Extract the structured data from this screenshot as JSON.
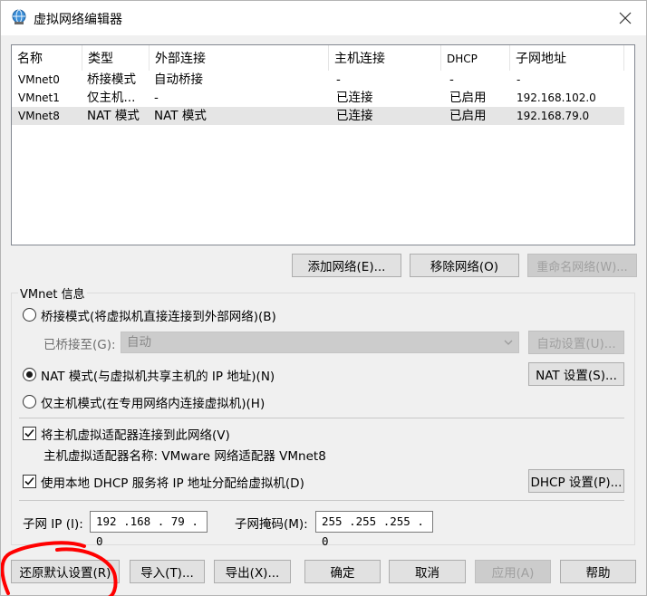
{
  "window": {
    "title": "虚拟网络编辑器"
  },
  "icons": {
    "app": "globe-network-icon",
    "close": "close-icon",
    "chevron": "chevron-down-icon",
    "check": "checkmark-icon"
  },
  "colors": {
    "annotation": "#ff0000",
    "selected_row": "#e5e5e5",
    "window_bg": "#f0f0f0"
  },
  "table": {
    "headers": [
      "名称",
      "类型",
      "外部连接",
      "主机连接",
      "DHCP",
      "子网地址"
    ],
    "rows": [
      [
        "VMnet0",
        "桥接模式",
        "自动桥接",
        "-",
        "-",
        "-"
      ],
      [
        "VMnet1",
        "仅主机...",
        "-",
        "已连接",
        "已启用",
        "192.168.102.0"
      ],
      [
        "VMnet8",
        "NAT 模式",
        "NAT 模式",
        "已连接",
        "已启用",
        "192.168.79.0"
      ]
    ],
    "selected_row": 2
  },
  "list_buttons": {
    "add": "添加网络(E)...",
    "remove": "移除网络(O)",
    "rename": "重命名网络(W)..."
  },
  "vmnet_info": {
    "label": "VMnet 信息",
    "bridge_radio": "桥接模式(将虚拟机直接连接到外部网络)(B)",
    "bridged_to_label": "已桥接至(G):",
    "bridged_to_value": "自动",
    "auto_settings": "自动设置(U)...",
    "nat_radio": "NAT 模式(与虚拟机共享主机的 IP 地址)(N)",
    "nat_settings": "NAT 设置(S)...",
    "hostonly_radio": "仅主机模式(在专用网络内连接虚拟机)(H)",
    "selected_mode": "nat",
    "connect_adapter_check": "将主机虚拟适配器连接到此网络(V)",
    "adapter_name": "主机虚拟适配器名称: VMware 网络适配器 VMnet8",
    "dhcp_check": "使用本地 DHCP 服务将 IP 地址分配给虚拟机(D)",
    "dhcp_settings": "DHCP 设置(P)...",
    "subnet_ip_label": "子网 IP (I):",
    "subnet_ip_value": "192 .168 . 79  .  0",
    "subnet_mask_label": "子网掩码(M):",
    "subnet_mask_value": "255 .255 .255 .  0"
  },
  "footer": {
    "restore": "还原默认设置(R)",
    "import": "导入(T)...",
    "export": "导出(X)...",
    "ok": "确定",
    "cancel": "取消",
    "apply": "应用(A)",
    "help": "帮助"
  }
}
